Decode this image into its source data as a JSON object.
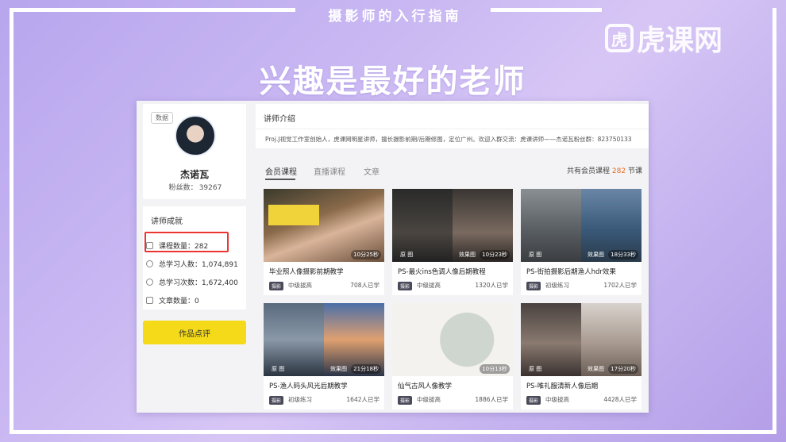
{
  "banner": {
    "header": "摄影师的入行指南",
    "slogan": "兴趣是最好的老师",
    "logo_mark": "虎",
    "logo_text": "虎课网"
  },
  "profile": {
    "tag": "数据",
    "name": "杰诺瓦",
    "fans_label": "粉丝数：",
    "fans_value": "39267"
  },
  "achievements": {
    "title": "讲师成就",
    "items": [
      {
        "label": "课程数量：282",
        "icon": "book-icon"
      },
      {
        "label": "总学习人数：1,074,891",
        "icon": "user-icon"
      },
      {
        "label": "总学习次数：1,672,400",
        "icon": "play-icon"
      },
      {
        "label": "文章数量：0",
        "icon": "document-icon"
      }
    ]
  },
  "review_button": "作品点评",
  "intro": {
    "title": "讲师介绍",
    "text": "Proj.J视觉工作室创始人，虎课网明星讲师，擅长摄影前期/后期修图，定位广州。欢迎入群交流：虎课讲师——杰诺瓦粉丝群：823750133"
  },
  "tabs": [
    "会员课程",
    "直播课程",
    "文章"
  ],
  "total": {
    "prefix": "共有会员课程",
    "count": "282",
    "suffix": "节课"
  },
  "courses": [
    {
      "title": "毕业照人像摄影前期教学",
      "badge": "摄影",
      "level": "中级拔高",
      "learners": "708人已学",
      "duration": "10分25秒",
      "before": "",
      "after": ""
    },
    {
      "title": "PS-最火ins色调人像后期教程",
      "badge": "摄影",
      "level": "中级拔高",
      "learners": "1320人已学",
      "duration": "10分23秒",
      "before": "原 图",
      "after": "效果图"
    },
    {
      "title": "PS-街拍摄影后期渔人hdr效果",
      "badge": "摄影",
      "level": "初级练习",
      "learners": "1702人已学",
      "duration": "18分33秒",
      "before": "原 图",
      "after": "效果图"
    },
    {
      "title": "PS-渔人码头风光后期教学",
      "badge": "摄影",
      "level": "初级练习",
      "learners": "1642人已学",
      "duration": "21分18秒",
      "before": "原 图",
      "after": "效果图"
    },
    {
      "title": "仙气古风人像教学",
      "badge": "摄影",
      "level": "中级拔高",
      "learners": "1886人已学",
      "duration": "10分13秒",
      "before": "",
      "after": ""
    },
    {
      "title": "PS-唯礼服清新人像后期",
      "badge": "摄影",
      "level": "中级拔高",
      "learners": "4428人已学",
      "duration": "17分20秒",
      "before": "原 图",
      "after": "效果图"
    }
  ],
  "colors": {
    "accent_yellow": "#f4da18",
    "count_orange": "#e56b1f",
    "highlight_red": "#ee3333"
  }
}
